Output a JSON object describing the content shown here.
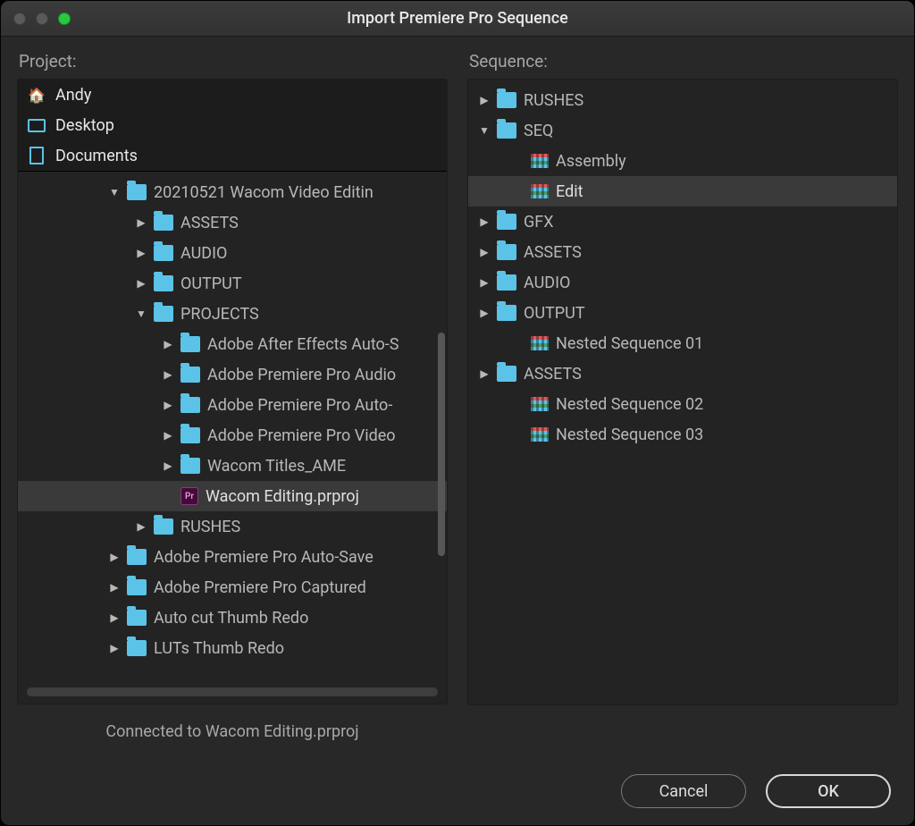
{
  "window": {
    "title": "Import Premiere Pro Sequence"
  },
  "labels": {
    "project": "Project:",
    "sequence": "Sequence:"
  },
  "roots": [
    {
      "icon": "home",
      "label": "Andy"
    },
    {
      "icon": "desktop",
      "label": "Desktop"
    },
    {
      "icon": "doc",
      "label": "Documents"
    }
  ],
  "project_tree": [
    {
      "indent": 100,
      "disclosure": "down",
      "icon": "folder",
      "label": "20210521 Wacom Video Editin",
      "selected": false
    },
    {
      "indent": 130,
      "disclosure": "right",
      "icon": "folder",
      "label": "ASSETS",
      "selected": false
    },
    {
      "indent": 130,
      "disclosure": "right",
      "icon": "folder",
      "label": "AUDIO",
      "selected": false
    },
    {
      "indent": 130,
      "disclosure": "right",
      "icon": "folder",
      "label": "OUTPUT",
      "selected": false
    },
    {
      "indent": 130,
      "disclosure": "down",
      "icon": "folder",
      "label": "PROJECTS",
      "selected": false
    },
    {
      "indent": 160,
      "disclosure": "right",
      "icon": "folder",
      "label": "Adobe After Effects Auto-S",
      "selected": false
    },
    {
      "indent": 160,
      "disclosure": "right",
      "icon": "folder",
      "label": "Adobe Premiere Pro Audio",
      "selected": false
    },
    {
      "indent": 160,
      "disclosure": "right",
      "icon": "folder",
      "label": "Adobe Premiere Pro Auto-",
      "selected": false
    },
    {
      "indent": 160,
      "disclosure": "right",
      "icon": "folder",
      "label": "Adobe Premiere Pro Video",
      "selected": false
    },
    {
      "indent": 160,
      "disclosure": "right",
      "icon": "folder",
      "label": "Wacom Titles_AME",
      "selected": false
    },
    {
      "indent": 160,
      "disclosure": "none",
      "icon": "pr",
      "label": "Wacom Editing.prproj",
      "selected": true
    },
    {
      "indent": 130,
      "disclosure": "right",
      "icon": "folder",
      "label": "RUSHES",
      "selected": false
    },
    {
      "indent": 100,
      "disclosure": "right",
      "icon": "folder",
      "label": "Adobe Premiere Pro Auto-Save",
      "selected": false
    },
    {
      "indent": 100,
      "disclosure": "right",
      "icon": "folder",
      "label": "Adobe Premiere Pro Captured",
      "selected": false
    },
    {
      "indent": 100,
      "disclosure": "right",
      "icon": "folder",
      "label": "Auto cut Thumb Redo",
      "selected": false
    },
    {
      "indent": 100,
      "disclosure": "right",
      "icon": "folder",
      "label": "LUTs Thumb Redo",
      "selected": false
    }
  ],
  "sequence_tree": [
    {
      "indent": 10,
      "disclosure": "right",
      "icon": "folder",
      "label": "RUSHES",
      "selected": false
    },
    {
      "indent": 10,
      "disclosure": "down",
      "icon": "folder",
      "label": "SEQ",
      "selected": false
    },
    {
      "indent": 48,
      "disclosure": "none",
      "icon": "seq",
      "label": "Assembly",
      "selected": false
    },
    {
      "indent": 48,
      "disclosure": "none",
      "icon": "seq",
      "label": "Edit",
      "selected": true
    },
    {
      "indent": 10,
      "disclosure": "right",
      "icon": "folder",
      "label": "GFX",
      "selected": false
    },
    {
      "indent": 10,
      "disclosure": "right",
      "icon": "folder",
      "label": "ASSETS",
      "selected": false
    },
    {
      "indent": 10,
      "disclosure": "right",
      "icon": "folder",
      "label": "AUDIO",
      "selected": false
    },
    {
      "indent": 10,
      "disclosure": "right",
      "icon": "folder",
      "label": "OUTPUT",
      "selected": false
    },
    {
      "indent": 48,
      "disclosure": "none",
      "icon": "seq",
      "label": "Nested Sequence 01",
      "selected": false
    },
    {
      "indent": 10,
      "disclosure": "right",
      "icon": "folder",
      "label": "ASSETS",
      "selected": false
    },
    {
      "indent": 48,
      "disclosure": "none",
      "icon": "seq",
      "label": "Nested Sequence 02",
      "selected": false
    },
    {
      "indent": 48,
      "disclosure": "none",
      "icon": "seq",
      "label": "Nested Sequence 03",
      "selected": false
    }
  ],
  "status": "Connected to Wacom Editing.prproj",
  "buttons": {
    "cancel": "Cancel",
    "ok": "OK"
  }
}
